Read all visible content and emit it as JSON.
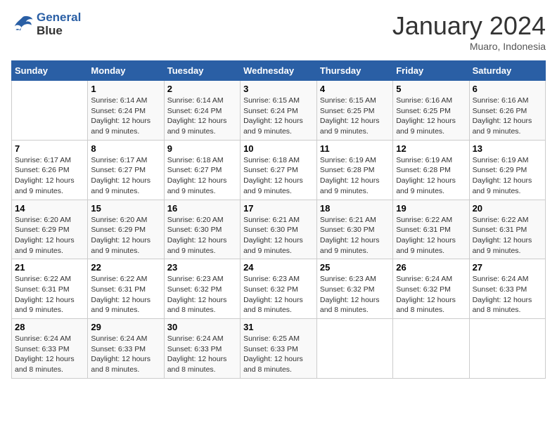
{
  "header": {
    "logo_line1": "General",
    "logo_line2": "Blue",
    "month_title": "January 2024",
    "location": "Muaro, Indonesia"
  },
  "weekdays": [
    "Sunday",
    "Monday",
    "Tuesday",
    "Wednesday",
    "Thursday",
    "Friday",
    "Saturday"
  ],
  "weeks": [
    [
      {
        "day": "",
        "sunrise": "",
        "sunset": "",
        "daylight": ""
      },
      {
        "day": "1",
        "sunrise": "Sunrise: 6:14 AM",
        "sunset": "Sunset: 6:24 PM",
        "daylight": "Daylight: 12 hours and 9 minutes."
      },
      {
        "day": "2",
        "sunrise": "Sunrise: 6:14 AM",
        "sunset": "Sunset: 6:24 PM",
        "daylight": "Daylight: 12 hours and 9 minutes."
      },
      {
        "day": "3",
        "sunrise": "Sunrise: 6:15 AM",
        "sunset": "Sunset: 6:24 PM",
        "daylight": "Daylight: 12 hours and 9 minutes."
      },
      {
        "day": "4",
        "sunrise": "Sunrise: 6:15 AM",
        "sunset": "Sunset: 6:25 PM",
        "daylight": "Daylight: 12 hours and 9 minutes."
      },
      {
        "day": "5",
        "sunrise": "Sunrise: 6:16 AM",
        "sunset": "Sunset: 6:25 PM",
        "daylight": "Daylight: 12 hours and 9 minutes."
      },
      {
        "day": "6",
        "sunrise": "Sunrise: 6:16 AM",
        "sunset": "Sunset: 6:26 PM",
        "daylight": "Daylight: 12 hours and 9 minutes."
      }
    ],
    [
      {
        "day": "7",
        "sunrise": "Sunrise: 6:17 AM",
        "sunset": "Sunset: 6:26 PM",
        "daylight": "Daylight: 12 hours and 9 minutes."
      },
      {
        "day": "8",
        "sunrise": "Sunrise: 6:17 AM",
        "sunset": "Sunset: 6:27 PM",
        "daylight": "Daylight: 12 hours and 9 minutes."
      },
      {
        "day": "9",
        "sunrise": "Sunrise: 6:18 AM",
        "sunset": "Sunset: 6:27 PM",
        "daylight": "Daylight: 12 hours and 9 minutes."
      },
      {
        "day": "10",
        "sunrise": "Sunrise: 6:18 AM",
        "sunset": "Sunset: 6:27 PM",
        "daylight": "Daylight: 12 hours and 9 minutes."
      },
      {
        "day": "11",
        "sunrise": "Sunrise: 6:19 AM",
        "sunset": "Sunset: 6:28 PM",
        "daylight": "Daylight: 12 hours and 9 minutes."
      },
      {
        "day": "12",
        "sunrise": "Sunrise: 6:19 AM",
        "sunset": "Sunset: 6:28 PM",
        "daylight": "Daylight: 12 hours and 9 minutes."
      },
      {
        "day": "13",
        "sunrise": "Sunrise: 6:19 AM",
        "sunset": "Sunset: 6:29 PM",
        "daylight": "Daylight: 12 hours and 9 minutes."
      }
    ],
    [
      {
        "day": "14",
        "sunrise": "Sunrise: 6:20 AM",
        "sunset": "Sunset: 6:29 PM",
        "daylight": "Daylight: 12 hours and 9 minutes."
      },
      {
        "day": "15",
        "sunrise": "Sunrise: 6:20 AM",
        "sunset": "Sunset: 6:29 PM",
        "daylight": "Daylight: 12 hours and 9 minutes."
      },
      {
        "day": "16",
        "sunrise": "Sunrise: 6:20 AM",
        "sunset": "Sunset: 6:30 PM",
        "daylight": "Daylight: 12 hours and 9 minutes."
      },
      {
        "day": "17",
        "sunrise": "Sunrise: 6:21 AM",
        "sunset": "Sunset: 6:30 PM",
        "daylight": "Daylight: 12 hours and 9 minutes."
      },
      {
        "day": "18",
        "sunrise": "Sunrise: 6:21 AM",
        "sunset": "Sunset: 6:30 PM",
        "daylight": "Daylight: 12 hours and 9 minutes."
      },
      {
        "day": "19",
        "sunrise": "Sunrise: 6:22 AM",
        "sunset": "Sunset: 6:31 PM",
        "daylight": "Daylight: 12 hours and 9 minutes."
      },
      {
        "day": "20",
        "sunrise": "Sunrise: 6:22 AM",
        "sunset": "Sunset: 6:31 PM",
        "daylight": "Daylight: 12 hours and 9 minutes."
      }
    ],
    [
      {
        "day": "21",
        "sunrise": "Sunrise: 6:22 AM",
        "sunset": "Sunset: 6:31 PM",
        "daylight": "Daylight: 12 hours and 9 minutes."
      },
      {
        "day": "22",
        "sunrise": "Sunrise: 6:22 AM",
        "sunset": "Sunset: 6:31 PM",
        "daylight": "Daylight: 12 hours and 9 minutes."
      },
      {
        "day": "23",
        "sunrise": "Sunrise: 6:23 AM",
        "sunset": "Sunset: 6:32 PM",
        "daylight": "Daylight: 12 hours and 8 minutes."
      },
      {
        "day": "24",
        "sunrise": "Sunrise: 6:23 AM",
        "sunset": "Sunset: 6:32 PM",
        "daylight": "Daylight: 12 hours and 8 minutes."
      },
      {
        "day": "25",
        "sunrise": "Sunrise: 6:23 AM",
        "sunset": "Sunset: 6:32 PM",
        "daylight": "Daylight: 12 hours and 8 minutes."
      },
      {
        "day": "26",
        "sunrise": "Sunrise: 6:24 AM",
        "sunset": "Sunset: 6:32 PM",
        "daylight": "Daylight: 12 hours and 8 minutes."
      },
      {
        "day": "27",
        "sunrise": "Sunrise: 6:24 AM",
        "sunset": "Sunset: 6:33 PM",
        "daylight": "Daylight: 12 hours and 8 minutes."
      }
    ],
    [
      {
        "day": "28",
        "sunrise": "Sunrise: 6:24 AM",
        "sunset": "Sunset: 6:33 PM",
        "daylight": "Daylight: 12 hours and 8 minutes."
      },
      {
        "day": "29",
        "sunrise": "Sunrise: 6:24 AM",
        "sunset": "Sunset: 6:33 PM",
        "daylight": "Daylight: 12 hours and 8 minutes."
      },
      {
        "day": "30",
        "sunrise": "Sunrise: 6:24 AM",
        "sunset": "Sunset: 6:33 PM",
        "daylight": "Daylight: 12 hours and 8 minutes."
      },
      {
        "day": "31",
        "sunrise": "Sunrise: 6:25 AM",
        "sunset": "Sunset: 6:33 PM",
        "daylight": "Daylight: 12 hours and 8 minutes."
      },
      {
        "day": "",
        "sunrise": "",
        "sunset": "",
        "daylight": ""
      },
      {
        "day": "",
        "sunrise": "",
        "sunset": "",
        "daylight": ""
      },
      {
        "day": "",
        "sunrise": "",
        "sunset": "",
        "daylight": ""
      }
    ]
  ]
}
